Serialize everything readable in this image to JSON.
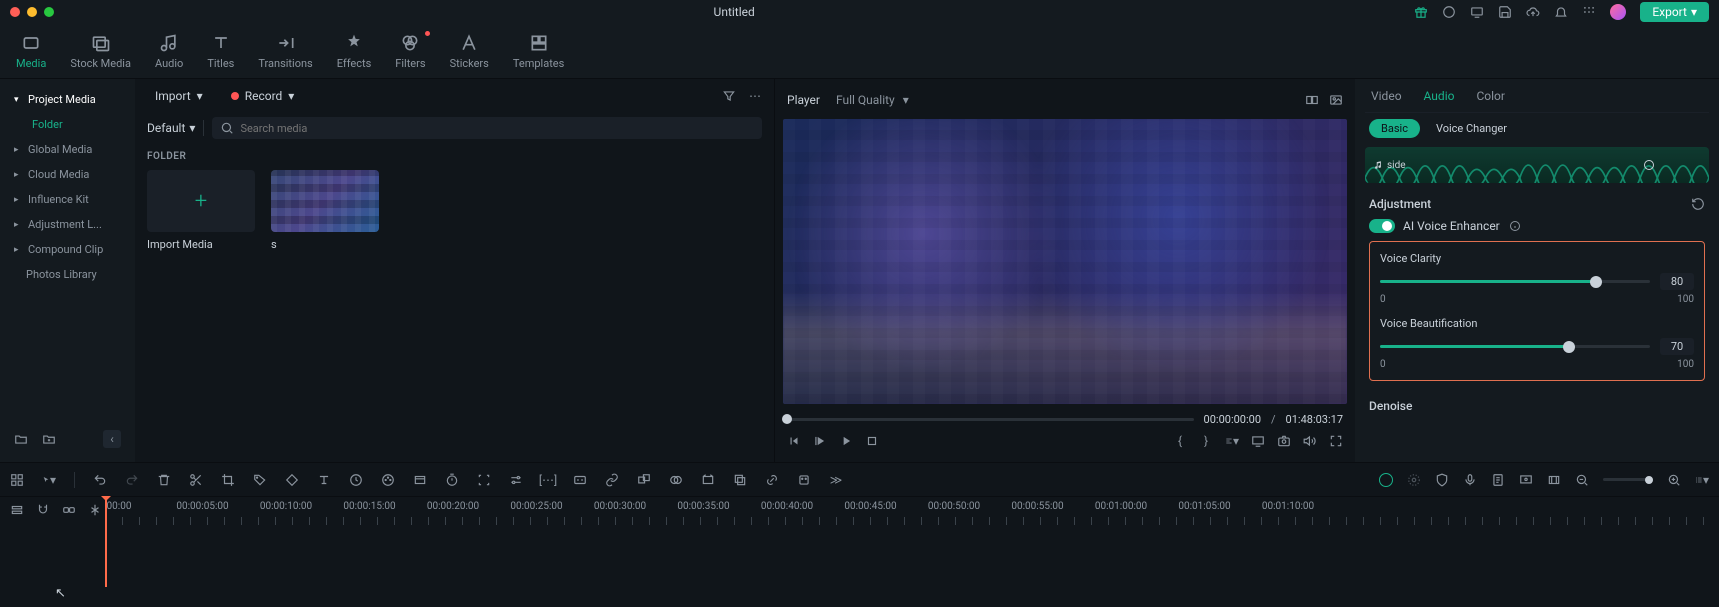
{
  "title": "Untitled",
  "export_label": "Export",
  "top_tabs": [
    "Media",
    "Stock Media",
    "Audio",
    "Titles",
    "Transitions",
    "Effects",
    "Filters",
    "Stickers",
    "Templates"
  ],
  "sidebar": {
    "items": [
      {
        "label": "Project Media"
      },
      {
        "label": "Folder"
      },
      {
        "label": "Global Media"
      },
      {
        "label": "Cloud Media"
      },
      {
        "label": "Influence Kit"
      },
      {
        "label": "Adjustment L..."
      },
      {
        "label": "Compound Clip"
      },
      {
        "label": "Photos Library"
      }
    ]
  },
  "media": {
    "import": "Import",
    "record": "Record",
    "default": "Default",
    "search_placeholder": "Search media",
    "folder_heading": "FOLDER",
    "import_card": "Import Media",
    "clip_name": "s"
  },
  "player": {
    "label": "Player",
    "quality": "Full Quality",
    "current": "00:00:00:00",
    "sep": "/",
    "total": "01:48:03:17"
  },
  "right": {
    "tabs": [
      "Video",
      "Audio",
      "Color"
    ],
    "sub_basic": "Basic",
    "sub_vc": "Voice Changer",
    "wave_label": "side",
    "adjustment": "Adjustment",
    "ai_voice": "AI Voice Enhancer",
    "clarity": {
      "label": "Voice Clarity",
      "value": "80",
      "min": "0",
      "max": "100",
      "pct": 80
    },
    "beauty": {
      "label": "Voice Beautification",
      "value": "70",
      "min": "0",
      "max": "100",
      "pct": 70
    },
    "denoise": "Denoise"
  },
  "timeline": {
    "marks": [
      "00:00",
      "00:00:05:00",
      "00:00:10:00",
      "00:00:15:00",
      "00:00:20:00",
      "00:00:25:00",
      "00:00:30:00",
      "00:00:35:00",
      "00:00:40:00",
      "00:00:45:00",
      "00:00:50:00",
      "00:00:55:00",
      "00:01:00:00",
      "00:01:05:00",
      "00:01:10:00"
    ]
  }
}
